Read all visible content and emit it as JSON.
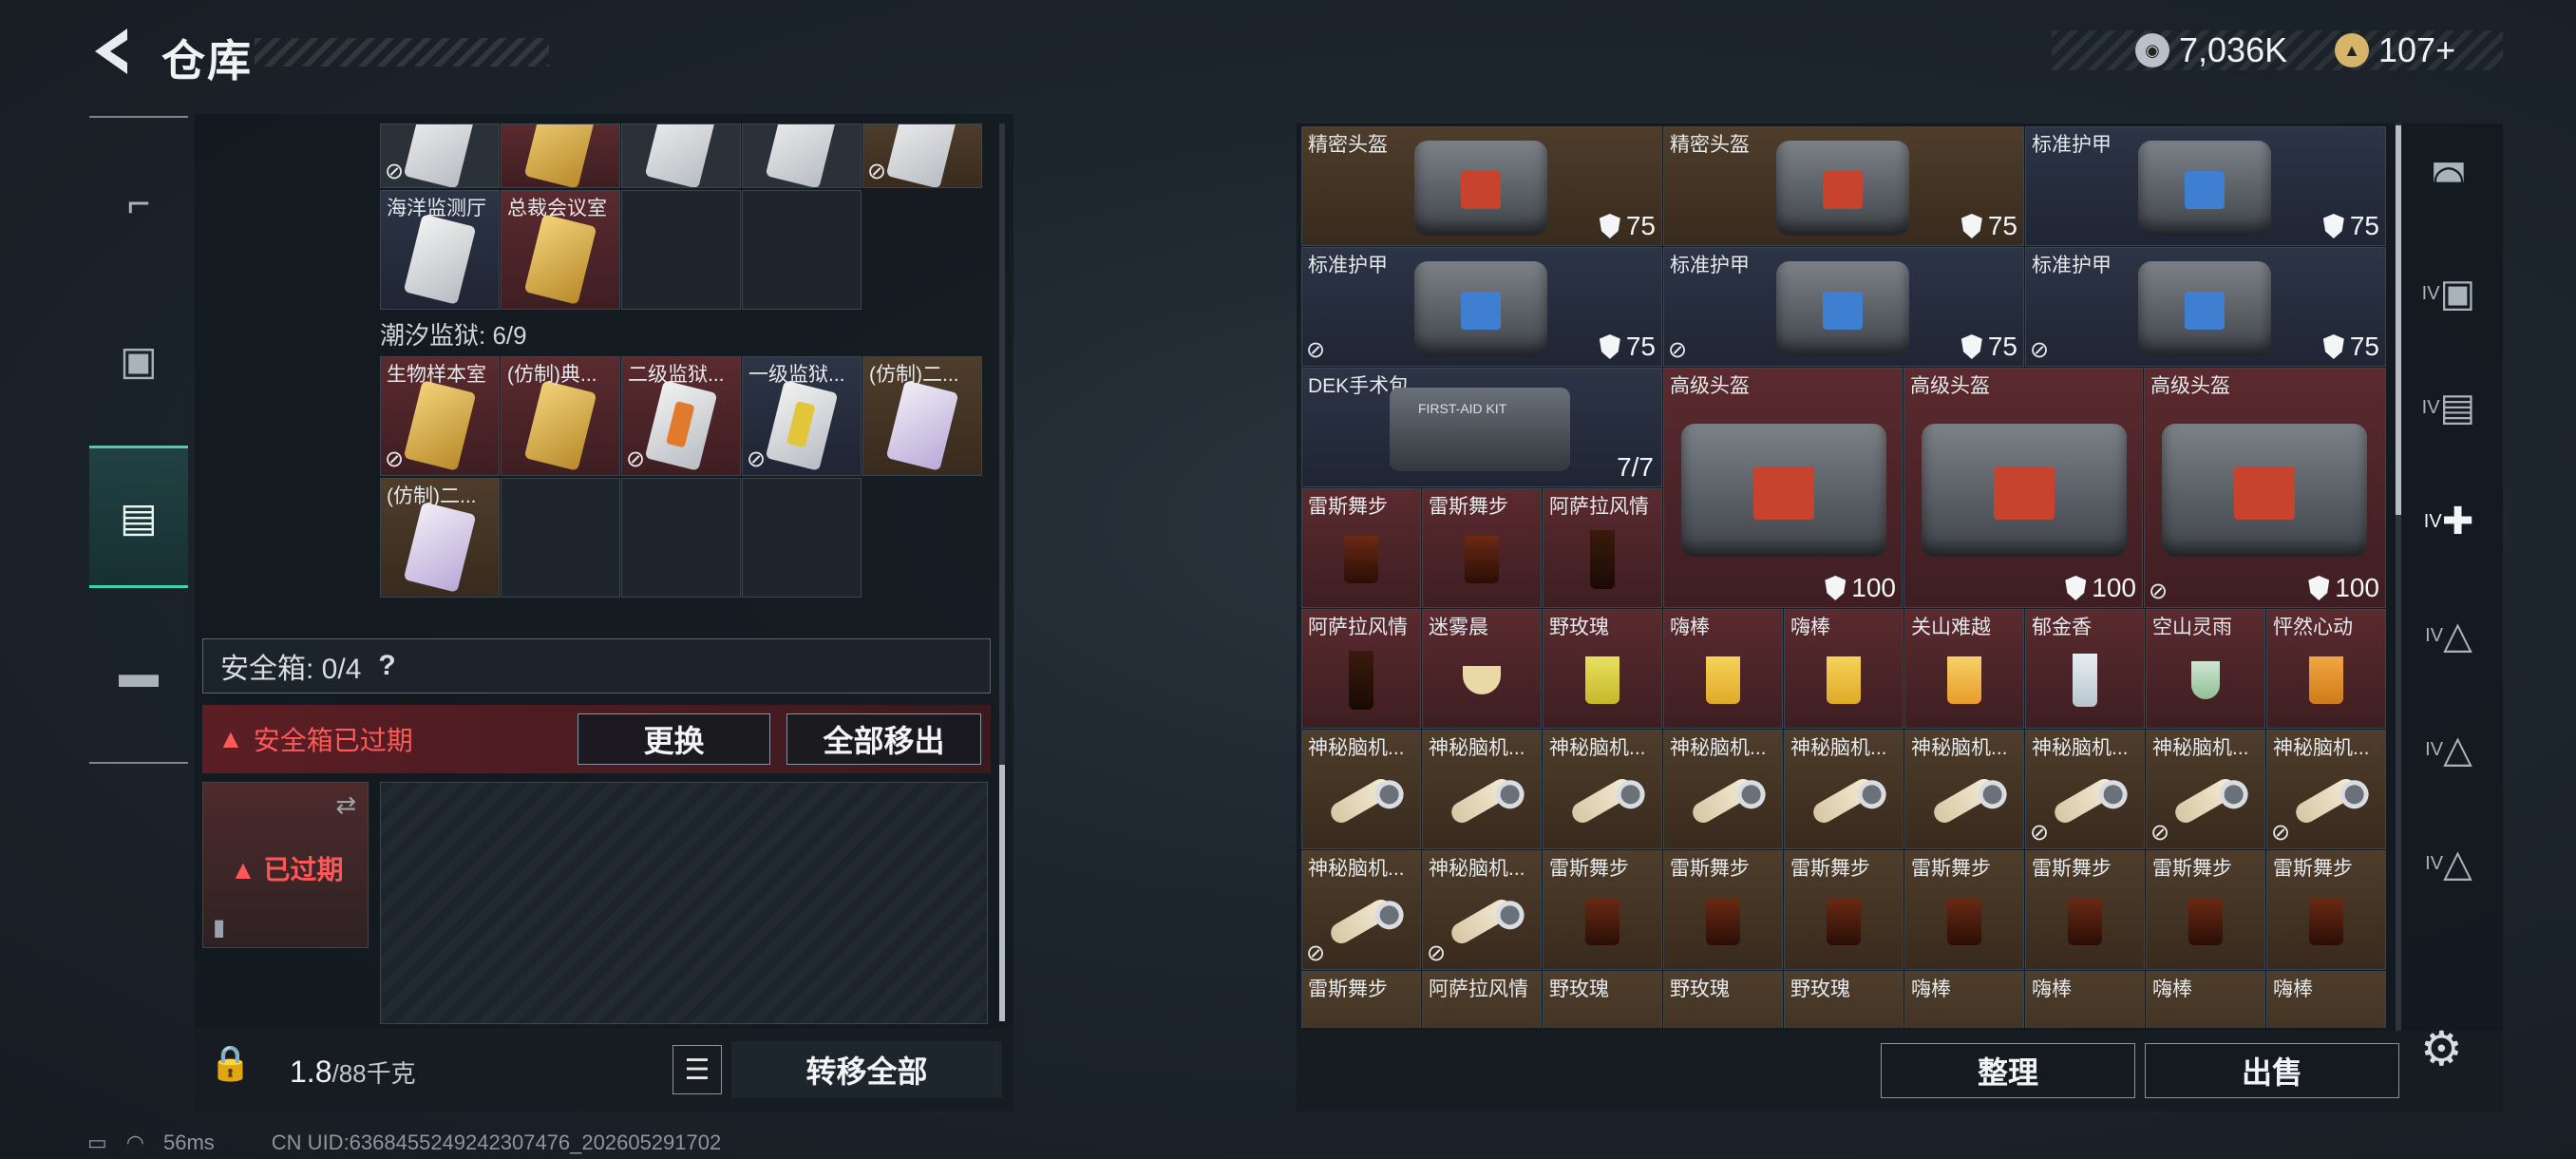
{
  "header": {
    "title": "仓库",
    "currency1": "7,036K",
    "currency2": "107+",
    "currency1_icon": "silver-coin-icon",
    "currency2_icon": "gold-coin-icon"
  },
  "left_nav": [
    "gun-icon",
    "armor-vest-icon",
    "backpack-icon",
    "toolbox-icon"
  ],
  "left_panel": {
    "row1_labels": [
      "海洋监测厅",
      "总裁会议室"
    ],
    "section_label": "潮汐监狱: 6/9",
    "row2_labels": [
      "生物样本室",
      "(仿制)典...",
      "二级监狱...",
      "一级监狱...",
      "(仿制)二..."
    ],
    "row3_labels": [
      "(仿制)二..."
    ],
    "safe_box_label": "安全箱: 0/4",
    "safe_box_help": "?",
    "expired_message": "安全箱已过期",
    "replace_button": "更换",
    "move_all_out_button": "全部移出",
    "expired_badge": "已过期",
    "weight_value": "1.8",
    "weight_max": "/88千克",
    "transfer_all_button": "转移全部"
  },
  "status_bar": {
    "ping": "56ms",
    "uid": "CN UID:636845524924230747​6_202605291702"
  },
  "right_panel": {
    "row1": [
      {
        "label": "精密头盔",
        "value": "75"
      },
      {
        "label": "精密头盔",
        "value": "75"
      },
      {
        "label": "标准护甲",
        "value": "75"
      }
    ],
    "row2": [
      {
        "label": "标准护甲",
        "value": "75"
      },
      {
        "label": "标准护甲",
        "value": "75"
      },
      {
        "label": "标准护甲",
        "value": "75"
      }
    ],
    "medkit": {
      "label": "DEK手术包",
      "count": "7/7",
      "kit_text": "FIRST-AID KIT"
    },
    "big": [
      {
        "label": "高级头盔",
        "value": "100"
      },
      {
        "label": "高级头盔",
        "value": "100"
      },
      {
        "label": "高级头盔",
        "value": "100"
      }
    ],
    "row3_small": [
      "雷斯舞步",
      "雷斯舞步",
      "阿萨拉风情"
    ],
    "row4": [
      "阿萨拉风情",
      "迷雾晨",
      "野玫瑰",
      "嗨棒",
      "嗨棒",
      "关山难越",
      "郁金香",
      "空山灵雨",
      "怦然心动"
    ],
    "row5": [
      "神秘脑机...",
      "神秘脑机...",
      "神秘脑机...",
      "神秘脑机...",
      "神秘脑机...",
      "神秘脑机...",
      "神秘脑机...",
      "神秘脑机...",
      "神秘脑机..."
    ],
    "row6": [
      "神秘脑机...",
      "神秘脑机...",
      "雷斯舞步",
      "雷斯舞步",
      "雷斯舞步",
      "雷斯舞步",
      "雷斯舞步",
      "雷斯舞步",
      "雷斯舞步"
    ],
    "row7": [
      "雷斯舞步",
      "阿萨拉风情",
      "野玫瑰",
      "野玫瑰",
      "野玫瑰",
      "嗨棒",
      "嗨棒",
      "嗨棒",
      "嗨棒"
    ],
    "sort_button": "整理",
    "sell_button": "出售"
  },
  "right_nav": [
    "helmet-icon",
    "iv-safe-icon",
    "iv-folder-icon",
    "iv-medkit-icon",
    "iv-warning-icon",
    "iv-warning-icon",
    "iv-warning-icon"
  ],
  "right_nav_labels": [
    "IV",
    "IV",
    "IV",
    "IV",
    "IV",
    "IV"
  ]
}
